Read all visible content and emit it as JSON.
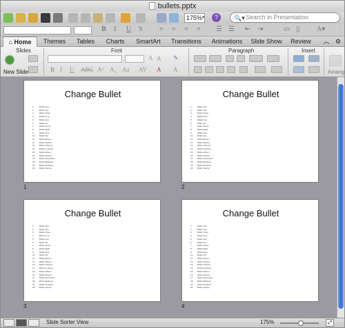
{
  "window": {
    "title": "bullets.pptx"
  },
  "toolbar": {
    "zoom": "175%",
    "search_placeholder": "Search in Presentation"
  },
  "ribbon": {
    "tabs": [
      "Home",
      "Themes",
      "Tables",
      "Charts",
      "SmartArt",
      "Transitions",
      "Animations",
      "Slide Show",
      "Review"
    ],
    "active_tab": "Home",
    "groups": [
      "Slides",
      "Font",
      "Paragraph",
      "Insert"
    ],
    "new_slide_label": "New Slide",
    "arrange_label": "Arrang"
  },
  "slides": [
    {
      "number": "1",
      "title": "Change Bullet"
    },
    {
      "number": "2",
      "title": "Change Bullet"
    },
    {
      "number": "3",
      "title": "Change Bullet"
    },
    {
      "number": "4",
      "title": "Change Bullet"
    }
  ],
  "bullet_items": [
    "Bullet One",
    "Bullet Two",
    "Bullet Three",
    "Bullet Four",
    "Bullet Five",
    "Bullet Six",
    "Bullet Seven",
    "Bullet Eight",
    "Bullet Nine",
    "Bullet Ten",
    "Bullet Eleven",
    "Bullet Twelve",
    "Bullet Thirteen",
    "Bullet Fourteen",
    "Bullet Fifteen",
    "Bullet Sixteen",
    "Bullet Seventeen",
    "Bullet Eighteen",
    "Bullet Nineteen",
    "Bullet Twenty"
  ],
  "status": {
    "view_label": "Slide Sorter View",
    "zoom": "175%",
    "zoom_level": 0.5
  },
  "colors": {
    "accent": "#2f6fd0",
    "sorter_bg": "#9a9aa0",
    "help": "#7d4fb8"
  }
}
